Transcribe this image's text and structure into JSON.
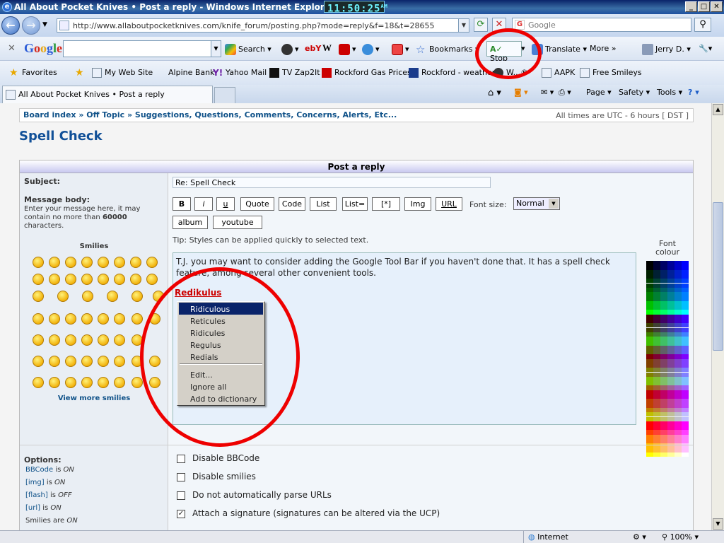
{
  "window": {
    "title": "All About Pocket Knives • Post a reply - Windows Internet Explorer",
    "clock": "11:50:25",
    "clock_ampm": "AM"
  },
  "address_bar": {
    "url": "http://www.allaboutpocketknives.com/knife_forum/posting.php?mode=reply&f=18&t=28655",
    "search_placeholder": "Google"
  },
  "google_toolbar": {
    "search_label": "Search",
    "bookmarks_label": "Bookmarks",
    "stop_label": "Stop",
    "translate_label": "Translate",
    "more_label": "More",
    "user_label": "Jerry D."
  },
  "favorites": {
    "label": "Favorites",
    "items": [
      "My Web Site",
      "Alpine Bank",
      "Yahoo Mail",
      "TV Zap2It",
      "Rockford Gas Prices",
      "Rockford - weather",
      "W...®",
      "AAPK",
      "Free Smileys"
    ]
  },
  "tab": {
    "title": "All About Pocket Knives • Post a reply"
  },
  "command_bar": {
    "page": "Page",
    "safety": "Safety",
    "tools": "Tools"
  },
  "forum": {
    "breadcrumb": [
      "Board index",
      "Off Topic",
      "Suggestions, Questions, Comments, Concerns, Alerts, Etc..."
    ],
    "timezone": "All times are UTC - 6 hours [ DST ]",
    "topic_title": "Spell Check",
    "form_header": "Post a reply",
    "subject_label": "Subject:",
    "subject_value": "Re: Spell Check",
    "message_body_label": "Message body:",
    "message_hint_1": "Enter your message here, it may contain no more than",
    "message_hint_limit": "60000",
    "message_hint_2": "characters.",
    "smilies_label": "Smilies",
    "view_more_smilies": "View more smilies",
    "bbcode_buttons": [
      "B",
      "i",
      "u",
      "Quote",
      "Code",
      "List",
      "List=",
      "[*]",
      "Img",
      "URL"
    ],
    "font_size_label": "Font size:",
    "font_size_value": "Normal",
    "extra_buttons": [
      "album",
      "youtube"
    ],
    "tip": "Tip: Styles can be applied quickly to selected text.",
    "font_colour_label": "Font colour",
    "message_text": "T.J. you may want to consider adding the Google Tool Bar if you haven't done that. It has a spell check feature, among several other convenient tools.",
    "misspelled_word": "Redikulus"
  },
  "spell_menu": {
    "suggestions": [
      "Ridiculous",
      "Reticules",
      "Ridicules",
      "Regulus",
      "Redials"
    ],
    "actions": [
      "Edit...",
      "Ignore all",
      "Add to dictionary"
    ]
  },
  "options": {
    "label": "Options:",
    "status": [
      {
        "name": "BBCode",
        "state": "ON"
      },
      {
        "name": "[img]",
        "state": "ON"
      },
      {
        "name": "[flash]",
        "state": "OFF"
      },
      {
        "name": "[url]",
        "state": "ON"
      },
      {
        "name": "Smilies are",
        "state": "ON"
      }
    ],
    "checkboxes": [
      {
        "label": "Disable BBCode",
        "checked": false
      },
      {
        "label": "Disable smilies",
        "checked": false
      },
      {
        "label": "Do not automatically parse URLs",
        "checked": false
      },
      {
        "label": "Attach a signature (signatures can be altered via the UCP)",
        "checked": true
      }
    ]
  },
  "status_bar": {
    "zone": "Internet",
    "zoom": "100%"
  },
  "colors": {
    "annotation": "#e00000",
    "link": "#105289",
    "title": "#115098"
  }
}
